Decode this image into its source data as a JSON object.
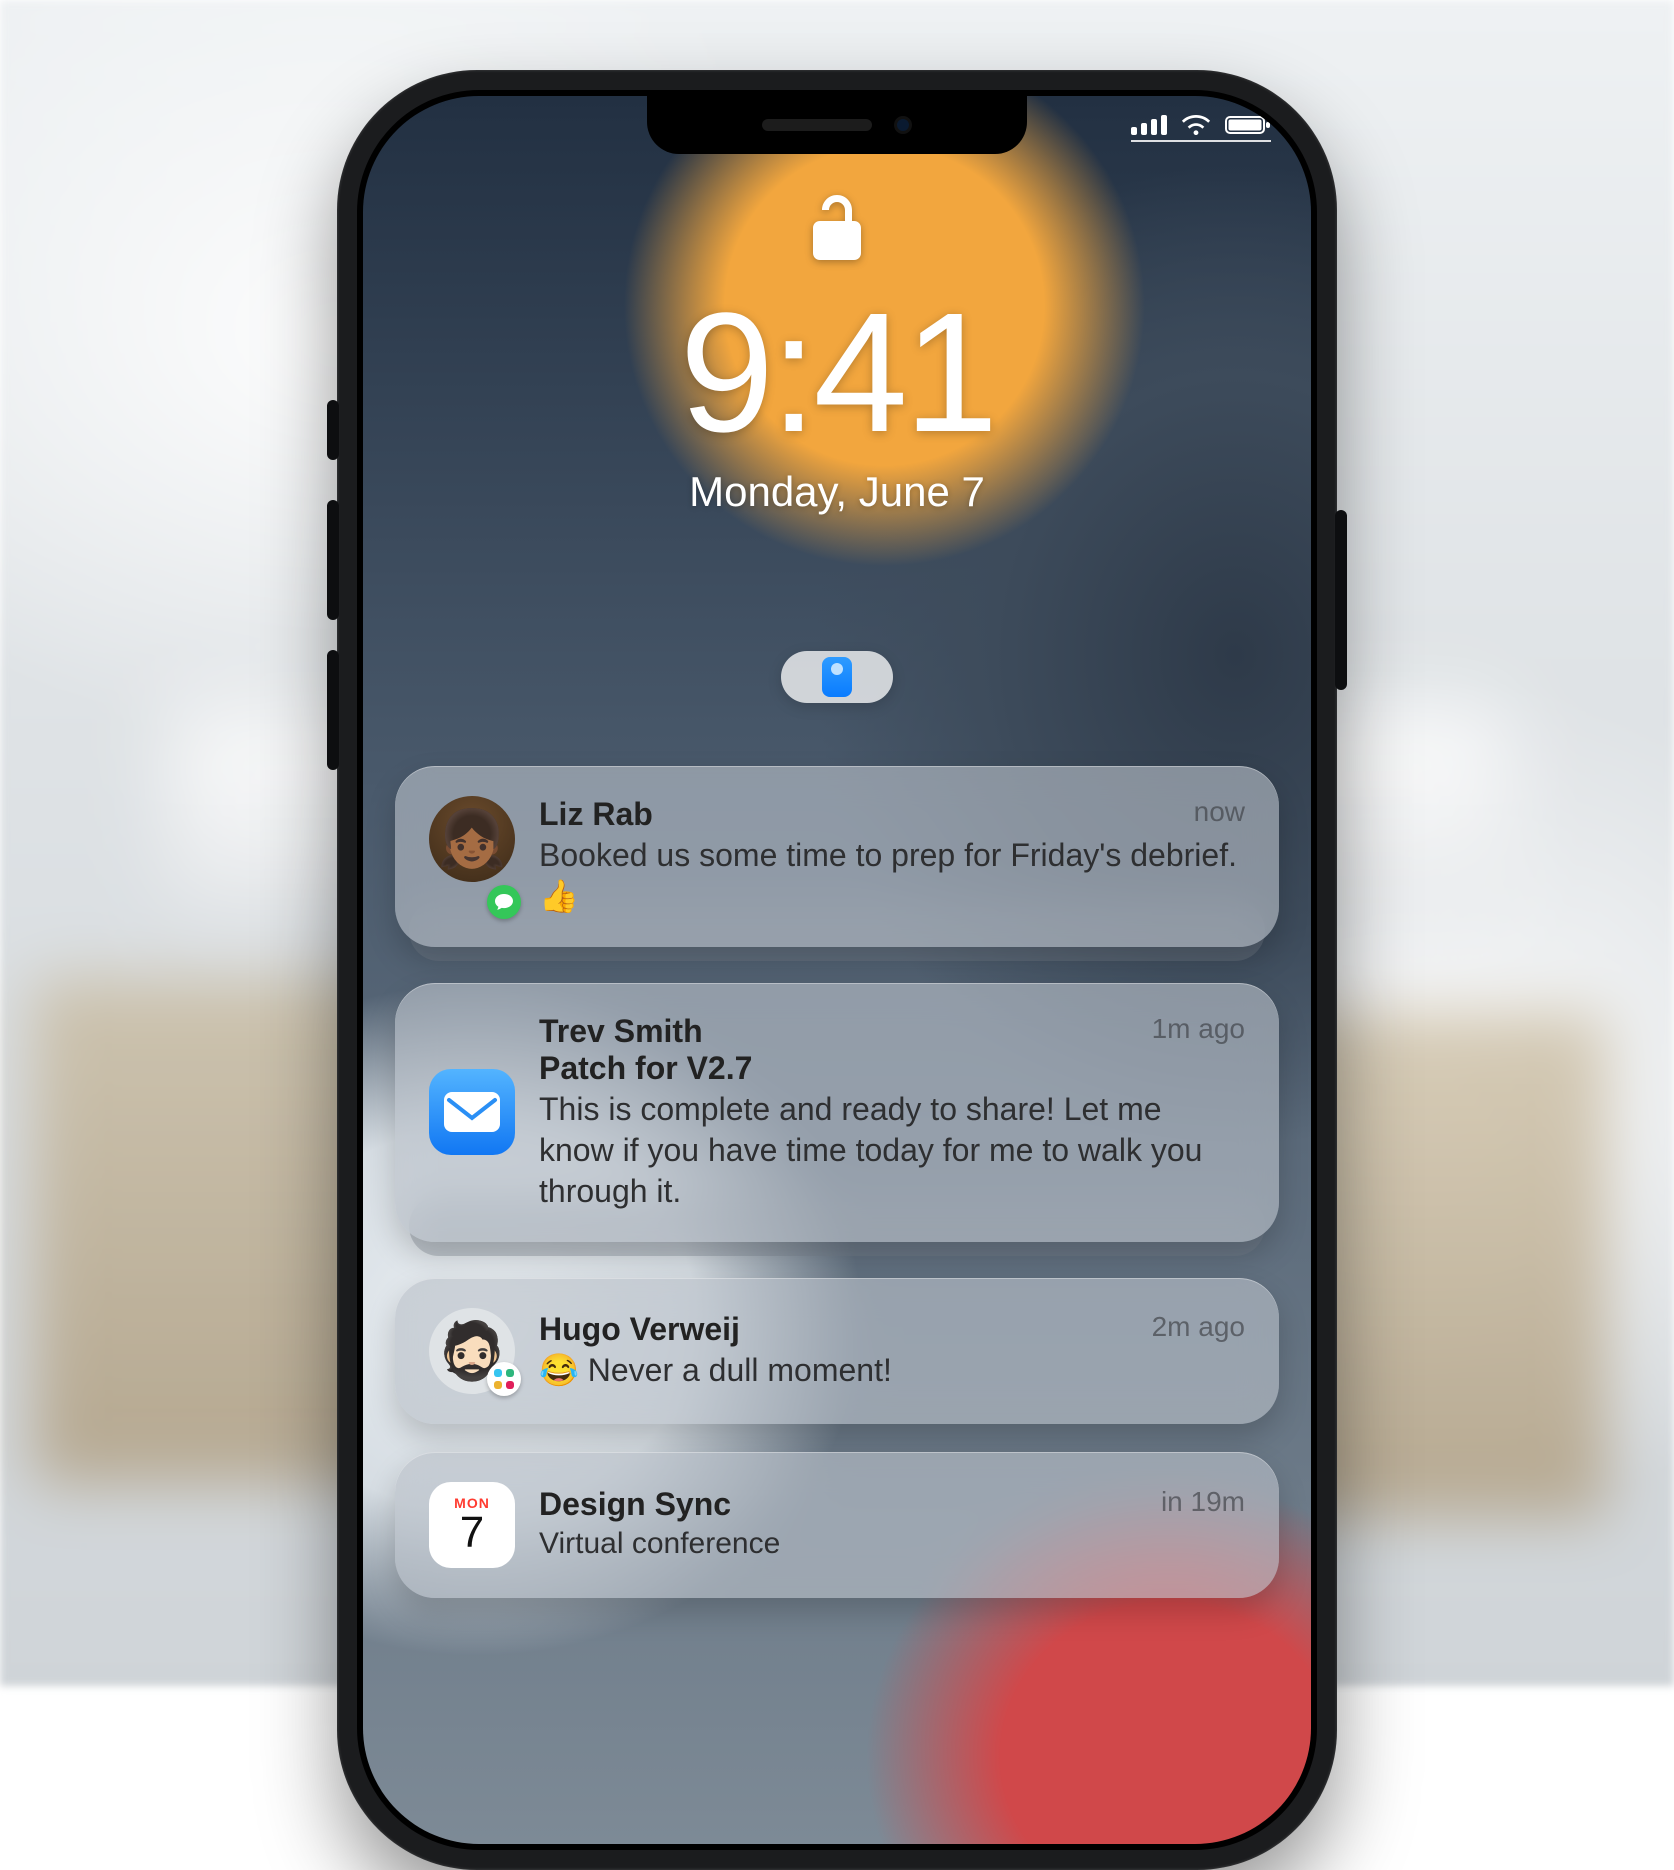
{
  "lockscreen": {
    "time": "9:41",
    "date": "Monday, June 7"
  },
  "notifications": [
    {
      "sender": "Liz Rab",
      "timestamp": "now",
      "message": "Booked us some time to prep for Friday's debrief. 👍",
      "app": "messages",
      "avatar_emoji": "👧🏾",
      "stacked": true
    },
    {
      "sender": "Trev Smith",
      "subject": "Patch for V2.7",
      "timestamp": "1m ago",
      "message": "This is complete and ready to share! Let me know if you have time today for me to walk you through it.",
      "app": "mail",
      "stacked": true
    },
    {
      "sender": "Hugo Verweij",
      "timestamp": "2m ago",
      "message": "😂 Never a dull moment!",
      "app": "slack",
      "avatar_emoji": "🧔🏻",
      "stacked": false
    },
    {
      "sender": "Design Sync",
      "timestamp": "in 19m",
      "message": "Virtual conference",
      "app": "calendar",
      "cal_weekday": "MON",
      "cal_day": "7",
      "stacked": false
    }
  ]
}
